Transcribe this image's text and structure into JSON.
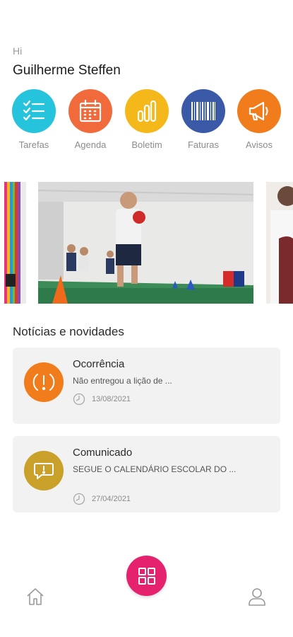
{
  "greeting": {
    "hi": "Hi",
    "name": "Guilherme Steffen"
  },
  "shortcuts": [
    {
      "label": "Tarefas",
      "icon": "checklist-icon",
      "color": "#25c4dc"
    },
    {
      "label": "Agenda",
      "icon": "calendar-icon",
      "color": "#f06a3c"
    },
    {
      "label": "Boletim",
      "icon": "bar-chart-icon",
      "color": "#f5b81a"
    },
    {
      "label": "Faturas",
      "icon": "barcode-icon",
      "color": "#3a5aa8"
    },
    {
      "label": "Avisos",
      "icon": "megaphone-icon",
      "color": "#f07c1c"
    }
  ],
  "news": {
    "title": "Notícias e novidades",
    "items": [
      {
        "title": "Ocorrência",
        "text": "Não entregou a lição de ...",
        "date": "13/08/2021",
        "icon": "alert-icon",
        "color": "#f07c1c"
      },
      {
        "title": "Comunicado",
        "text": "SEGUE O CALENDÁRIO ESCOLAR DO ...",
        "date": "27/04/2021",
        "icon": "message-icon",
        "color": "#c8a02a"
      }
    ]
  },
  "colors": {
    "fab": "#e5226e",
    "card_bg": "#f2f2f2"
  },
  "bottom_nav": {
    "home_icon": "home-icon",
    "grid_icon": "grid-icon",
    "profile_icon": "user-icon"
  }
}
